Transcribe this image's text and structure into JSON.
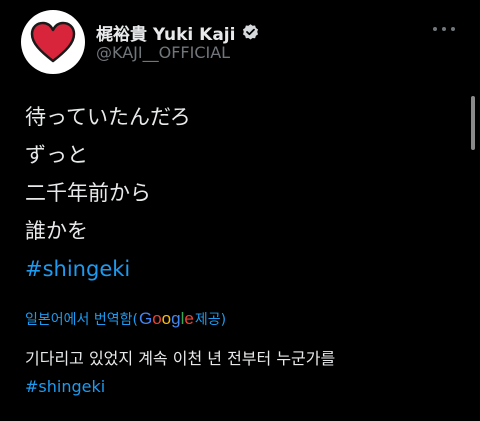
{
  "profile": {
    "display_name": "梶裕貴 Yuki Kaji",
    "handle": "@KAJI__OFFICIAL",
    "avatar_icon": "red-heart-icon",
    "verified_icon": "verified-badge-icon",
    "more_icon": "more-options-icon"
  },
  "tweet": {
    "lines": [
      "待っていたんだろ",
      "ずっと",
      "二千年前から",
      "誰かを"
    ],
    "hashtag": "#shingeki"
  },
  "translation": {
    "prefix": "일본어에서 번역함(",
    "google": [
      "G",
      "o",
      "o",
      "g",
      "l",
      "e"
    ],
    "suffix": " 제공)",
    "text": "기다리고 있었지 계속 이천 년 전부터 누군가를",
    "hashtag": "#shingeki"
  },
  "colors": {
    "background": "#000000",
    "text": "#e7e9ea",
    "secondary": "#71767b",
    "link": "#1d9bf0",
    "heart": "#d9253b",
    "google_blue": "#4285f4",
    "google_red": "#ea4335",
    "google_yellow": "#fbbc05",
    "google_green": "#34a853"
  }
}
